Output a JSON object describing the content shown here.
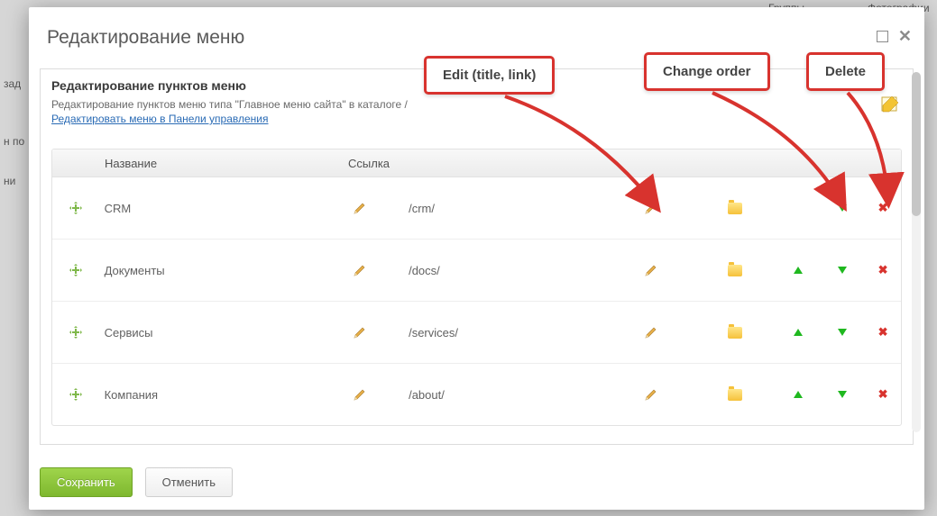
{
  "bg": {
    "t1": "зад",
    "t2": "н по",
    "t3": "ни",
    "t4": "Группы",
    "t5": "Фотографии"
  },
  "dialog": {
    "title": "Редактирование меню",
    "section_title": "Редактирование пунктов меню",
    "section_sub": "Редактирование пунктов меню типа \"Главное меню сайта\" в каталоге /",
    "section_link": "Редактировать меню в Панели управления"
  },
  "columns": {
    "name": "Название",
    "link": "Ссылка"
  },
  "rows": [
    {
      "name": "CRM",
      "link": "/crm/",
      "has_up": false,
      "has_down": true
    },
    {
      "name": "Документы",
      "link": "/docs/",
      "has_up": true,
      "has_down": true
    },
    {
      "name": "Сервисы",
      "link": "/services/",
      "has_up": true,
      "has_down": true
    },
    {
      "name": "Компания",
      "link": "/about/",
      "has_up": true,
      "has_down": true
    }
  ],
  "buttons": {
    "save": "Сохранить",
    "cancel": "Отменить"
  },
  "callouts": {
    "edit": "Edit (title, link)",
    "order": "Change order",
    "delete": "Delete"
  }
}
